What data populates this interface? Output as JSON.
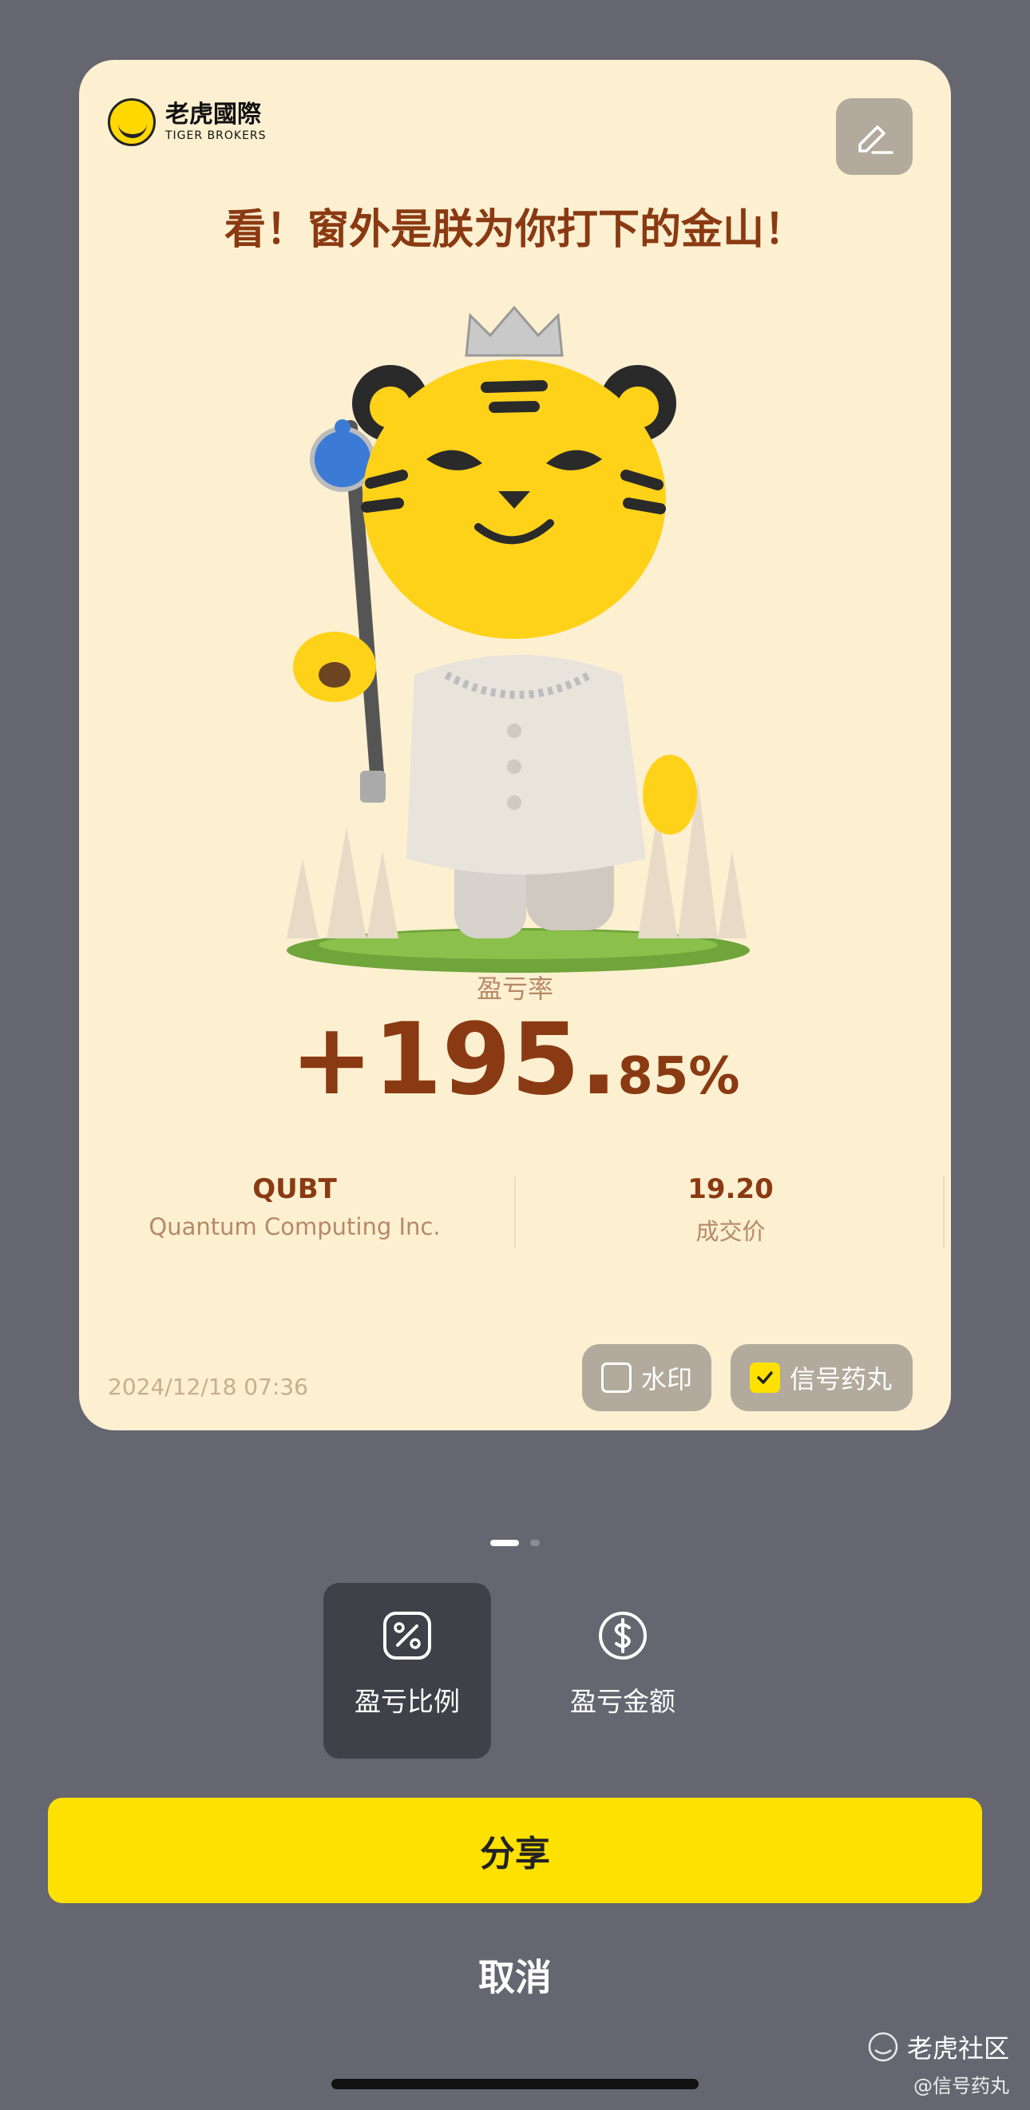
{
  "card": {
    "brand": {
      "name_cn": "老虎國際",
      "name_en": "TIGER BROKERS",
      "icon": "tiger-logo-icon"
    },
    "edit_icon": "edit-icon",
    "headline": "看！窗外是朕为你打下的金山！",
    "mascot_icon": "tiger-king-mascot",
    "metric_label": "盈亏率",
    "metric_value_main": "+195.",
    "metric_value_decimal": "85%",
    "symbol": "QUBT",
    "company": "Quantum Computing Inc.",
    "price": "19.20",
    "price_label": "成交价",
    "timestamp": "2024/12/18 07:36",
    "toggles": [
      {
        "label": "水印",
        "checked": false
      },
      {
        "label": "信号药丸",
        "checked": true
      }
    ]
  },
  "pager": {
    "pages": 2,
    "active": 1
  },
  "modes": [
    {
      "label": "盈亏比例",
      "icon": "percent-icon",
      "selected": true
    },
    {
      "label": "盈亏金额",
      "icon": "dollar-icon",
      "selected": false
    }
  ],
  "actions": {
    "share": "分享",
    "cancel": "取消"
  },
  "watermark": {
    "brand": "老虎社区",
    "user": "@信号药丸"
  },
  "colors": {
    "accent": "#FFE100",
    "card_bg": "#FCF0D1",
    "primary_text": "#8A3A12",
    "overlay": "#666670"
  }
}
